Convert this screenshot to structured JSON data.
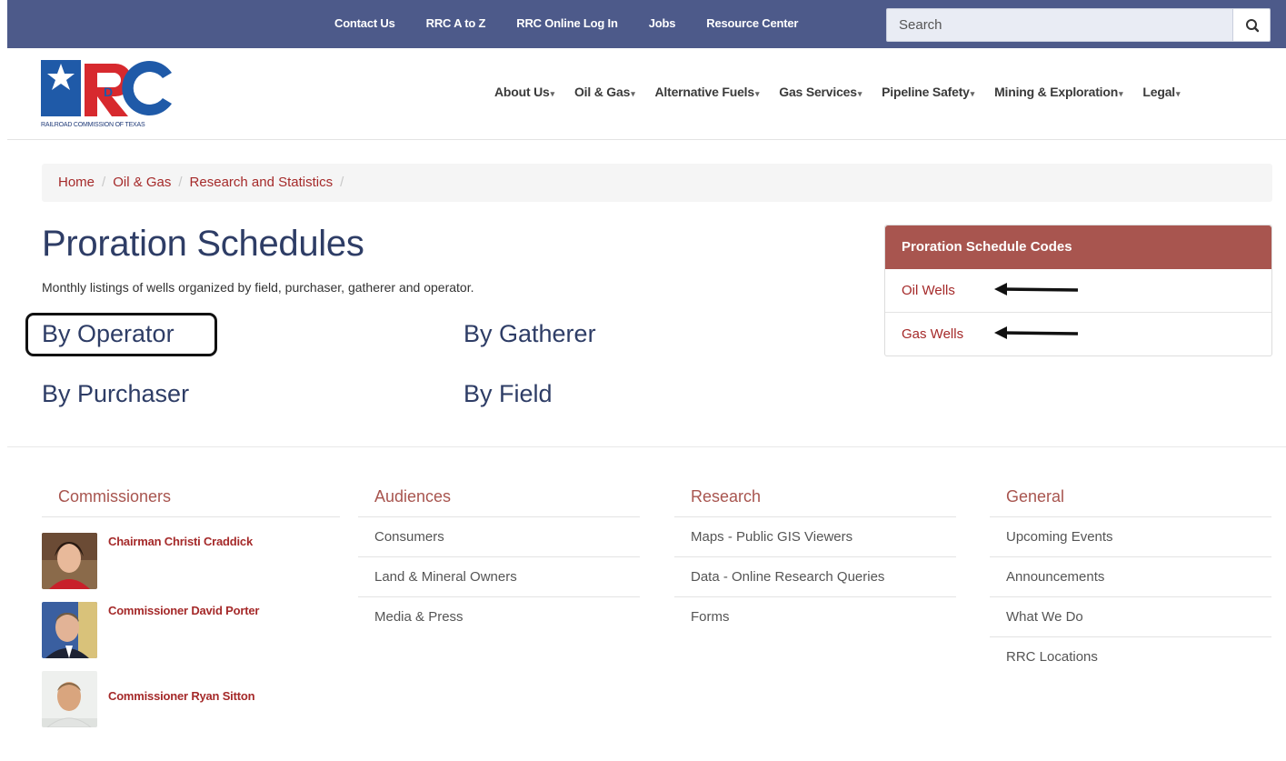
{
  "top_nav": {
    "links": [
      "Contact Us",
      "RRC A to Z",
      "RRC Online Log In",
      "Jobs",
      "Resource Center"
    ],
    "search_placeholder": "Search"
  },
  "logo": {
    "letters": "RRC",
    "tagline": "RAILROAD COMMISSION OF TEXAS"
  },
  "main_nav": [
    "About Us",
    "Oil & Gas",
    "Alternative Fuels",
    "Gas Services",
    "Pipeline Safety",
    "Mining & Exploration",
    "Legal"
  ],
  "breadcrumb": [
    "Home",
    "Oil & Gas",
    "Research and Statistics"
  ],
  "page": {
    "title": "Proration Schedules",
    "description": "Monthly listings of wells organized by field,  purchaser, gatherer and operator.",
    "links": [
      "By Operator",
      "By Gatherer",
      "By Purchaser",
      "By Field"
    ]
  },
  "panel": {
    "title": "Proration Schedule Codes",
    "items": [
      "Oil Wells",
      "Gas Wells"
    ]
  },
  "footer": {
    "commissioners": {
      "heading": "Commissioners",
      "people": [
        "Chairman Christi Craddick",
        "Commissioner David Porter",
        "Commissioner Ryan Sitton"
      ]
    },
    "audiences": {
      "heading": "Audiences",
      "links": [
        "Consumers",
        "Land & Mineral Owners",
        "Media & Press"
      ]
    },
    "research": {
      "heading": "Research",
      "links": [
        "Maps - Public GIS Viewers",
        "Data - Online Research Queries",
        "Forms"
      ]
    },
    "general": {
      "heading": "General",
      "links": [
        "Upcoming Events",
        "Announcements",
        "What We Do",
        "RRC Locations"
      ]
    }
  },
  "colors": {
    "topbar": "#4d5a8a",
    "accent": "#a8554f",
    "link": "#a52a2a",
    "title": "#2e3d66"
  },
  "icons": [
    "search-icon",
    "dropdown-caret-icon",
    "arrow-left-icon"
  ]
}
